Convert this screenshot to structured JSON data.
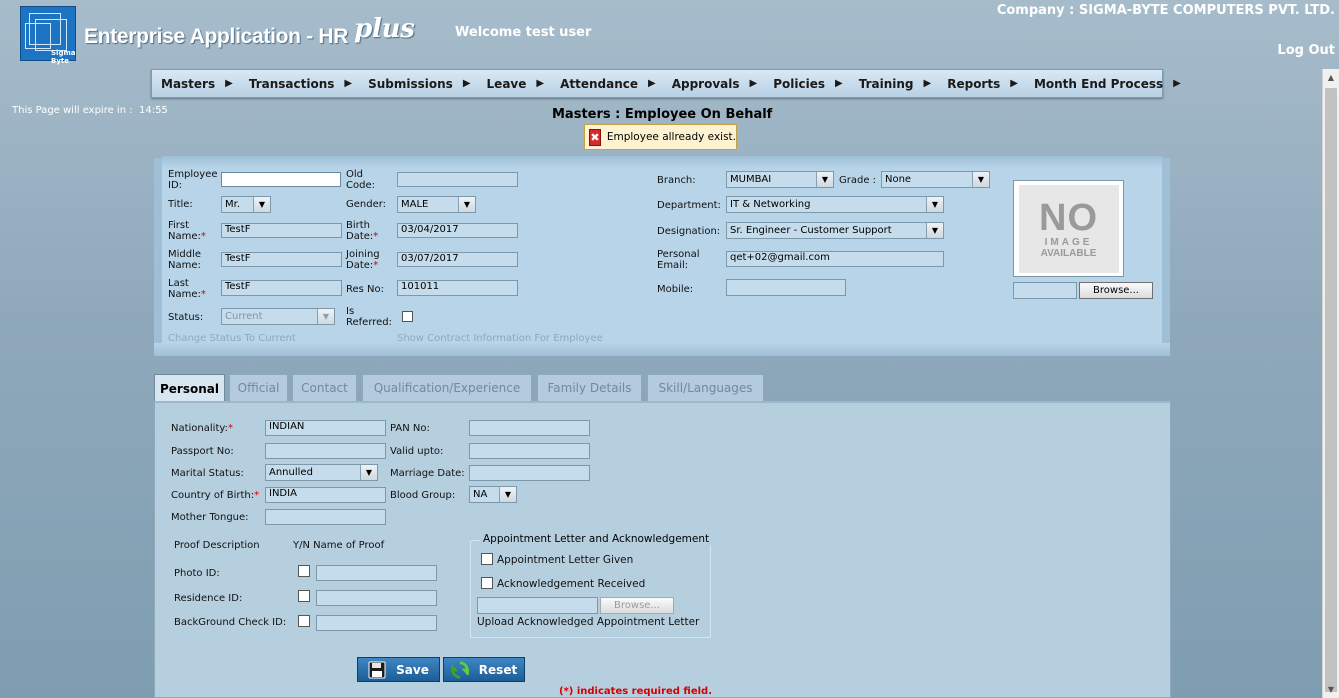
{
  "header": {
    "logo_caption": "Sigma Byte",
    "app_title": "Enterprise Application - HR",
    "app_title_suffix": "plus",
    "welcome": "Welcome test user",
    "company": "Company : SIGMA-BYTE COMPUTERS PVT. LTD.",
    "logout": "Log Out"
  },
  "menu": [
    "Masters",
    "Transactions",
    "Submissions",
    "Leave",
    "Attendance",
    "Approvals",
    "Policies",
    "Training",
    "Reports",
    "Month End Process"
  ],
  "session": {
    "expire_label": "This Page will expire in :",
    "expire_time": "14:55"
  },
  "page_title": "Masters : Employee On Behalf",
  "alert": {
    "message": "Employee allready exist."
  },
  "employee": {
    "employee_id_label_1": "Employee",
    "employee_id_label_2": "ID:",
    "employee_id": "",
    "old_code_label_1": "Old",
    "old_code_label_2": "Code:",
    "old_code": "",
    "title_label": "Title:",
    "title": "Mr.",
    "gender_label": "Gender:",
    "gender": "MALE",
    "first_name_label_1": "First",
    "first_name_label_2": "Name:",
    "first_name": "TestF",
    "birth_date_label_1": "Birth",
    "birth_date_label_2": "Date:",
    "birth_date": "03/04/2017",
    "middle_name_label_1": "Middle",
    "middle_name_label_2": "Name:",
    "middle_name": "TestF",
    "joining_date_label_1": "Joining",
    "joining_date_label_2": "Date:",
    "joining_date": "03/07/2017",
    "last_name_label_1": "Last",
    "last_name_label_2": "Name:",
    "last_name": "TestF",
    "res_no_label": "Res No:",
    "res_no": "101011",
    "status_label": "Status:",
    "status": "Current",
    "is_referred_label_1": "Is",
    "is_referred_label_2": "Referred:",
    "change_status_link": "Change Status To Current",
    "show_contract_link": "Show Contract Information For Employee",
    "branch_label": "Branch:",
    "branch": "MUMBAI",
    "grade_label": "Grade :",
    "grade": "None",
    "department_label": "Department:",
    "department": "IT & Networking",
    "designation_label": "Designation:",
    "designation": "Sr. Engineer - Customer Support",
    "email_label_1": "Personal",
    "email_label_2": "Email:",
    "email": "qet+02@gmail.com",
    "mobile_label": "Mobile:",
    "mobile": "",
    "no_image_1": "NO",
    "no_image_2": "IMAGE",
    "no_image_3": "AVAILABLE",
    "photo_path": "",
    "browse_label": "Browse..."
  },
  "tabs": [
    "Personal",
    "Official",
    "Contact",
    "Qualification/Experience",
    "Family Details",
    "Skill/Languages"
  ],
  "personal": {
    "nationality_label": "Nationality:",
    "nationality": "INDIAN",
    "pan_label": "PAN No:",
    "pan": "",
    "passport_label": "Passport No:",
    "passport": "",
    "valid_upto_label": "Valid upto:",
    "valid_upto": "",
    "marital_label": "Marital Status:",
    "marital": "Annulled",
    "marriage_date_label": "Marriage Date:",
    "marriage_date": "",
    "country_label": "Country of Birth:",
    "country": "INDIA",
    "blood_label": "Blood Group:",
    "blood": "NA",
    "mother_tongue_label": "Mother Tongue:",
    "mother_tongue": "",
    "proof_desc_label": "Proof Description",
    "proof_yn_label": "Y/N Name of Proof",
    "proofs": [
      {
        "label": "Photo ID:",
        "value": ""
      },
      {
        "label": "Residence ID:",
        "value": ""
      },
      {
        "label": "BackGround Check ID:",
        "value": ""
      }
    ],
    "appt_legend": "Appointment Letter and Acknowledgement",
    "appt_given": "Appointment Letter Given",
    "ack_received": "Acknowledgement Received",
    "ack_file": "",
    "ack_browse": "Browse...",
    "ack_upload_label": "Upload Acknowledged Appointment Letter"
  },
  "actions": {
    "save": "Save",
    "reset": "Reset"
  },
  "required_note": "(*) indicates required field."
}
